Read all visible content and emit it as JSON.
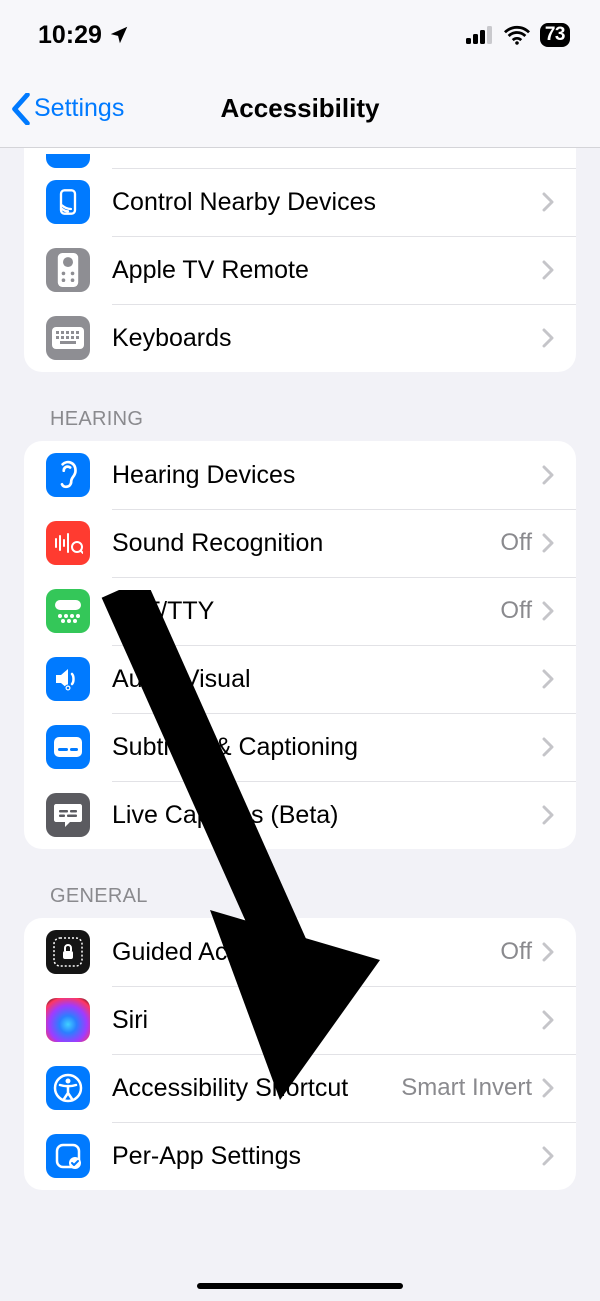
{
  "status": {
    "time": "10:29",
    "battery": "73"
  },
  "nav": {
    "back": "Settings",
    "title": "Accessibility"
  },
  "groups": [
    {
      "key": "physical_cont",
      "header": null,
      "truncated_top": true,
      "rows": [
        {
          "key": "truncated",
          "label": "",
          "detail": null,
          "iconClass": "bg-blue",
          "icon": null,
          "truncated": true
        },
        {
          "key": "control-nearby",
          "label": "Control Nearby Devices",
          "detail": null,
          "iconClass": "bg-blue",
          "icon": "nearby"
        },
        {
          "key": "apple-tv-remote",
          "label": "Apple TV Remote",
          "detail": null,
          "iconClass": "bg-gray",
          "icon": "remote"
        },
        {
          "key": "keyboards",
          "label": "Keyboards",
          "detail": null,
          "iconClass": "bg-gray",
          "icon": "keyboard"
        }
      ]
    },
    {
      "key": "hearing",
      "header": "HEARING",
      "rows": [
        {
          "key": "hearing-devices",
          "label": "Hearing Devices",
          "detail": null,
          "iconClass": "bg-blue",
          "icon": "ear"
        },
        {
          "key": "sound-recognition",
          "label": "Sound Recognition",
          "detail": "Off",
          "iconClass": "bg-red",
          "icon": "sound"
        },
        {
          "key": "rtt-tty",
          "label": "RTT/TTY",
          "detail": "Off",
          "iconClass": "bg-green",
          "icon": "tty"
        },
        {
          "key": "audio-visual",
          "label": "Audio/Visual",
          "detail": null,
          "iconClass": "bg-blue",
          "icon": "speaker"
        },
        {
          "key": "subtitles",
          "label": "Subtitles & Captioning",
          "detail": null,
          "iconClass": "bg-blue",
          "icon": "captions"
        },
        {
          "key": "live-captions",
          "label": "Live Captions (Beta)",
          "detail": null,
          "iconClass": "bg-darkgray",
          "icon": "livecap"
        }
      ]
    },
    {
      "key": "general",
      "header": "GENERAL",
      "rows": [
        {
          "key": "guided-access",
          "label": "Guided Access",
          "detail": "Off",
          "iconClass": "bg-black",
          "icon": "lock"
        },
        {
          "key": "siri",
          "label": "Siri",
          "detail": null,
          "iconClass": "bg-siri",
          "icon": null
        },
        {
          "key": "accessibility-shortcut",
          "label": "Accessibility Shortcut",
          "detail": "Smart Invert",
          "iconClass": "bg-blue",
          "icon": "a11y"
        },
        {
          "key": "per-app-settings",
          "label": "Per-App Settings",
          "detail": null,
          "iconClass": "bg-blue",
          "icon": "perapp"
        }
      ]
    }
  ]
}
